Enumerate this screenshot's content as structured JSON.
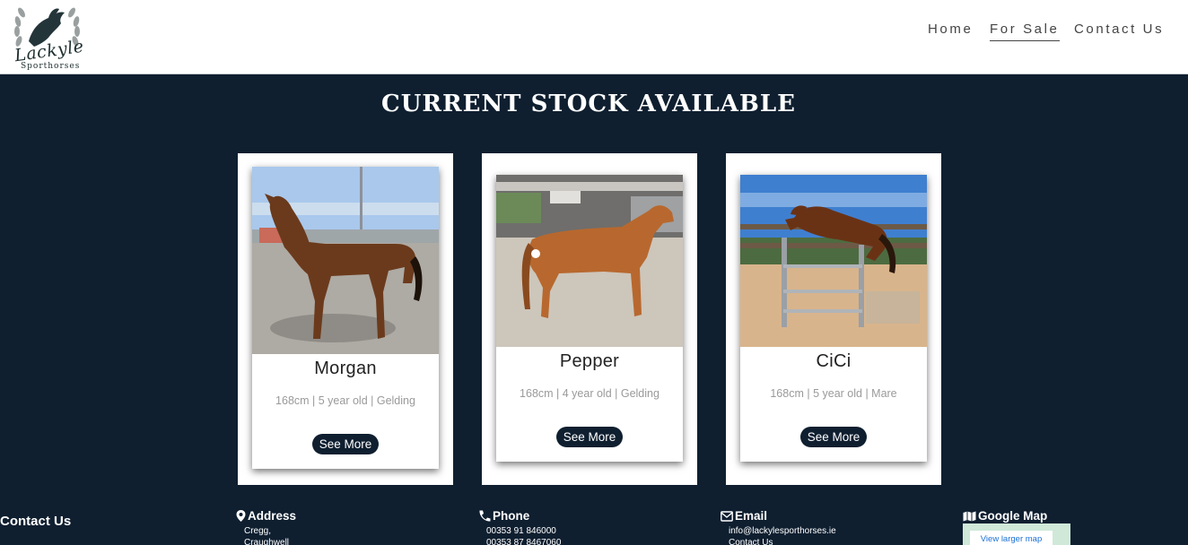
{
  "header": {
    "logo_text": "Lackyle",
    "logo_subtext": "Sporthorses",
    "nav": {
      "home": "Home",
      "for_sale": "For Sale",
      "contact_us": "Contact Us"
    }
  },
  "main": {
    "title": "CURRENT STOCK AVAILABLE",
    "horses": [
      {
        "name": "Morgan",
        "info": "168cm | 5 year old | Gelding",
        "button": "See More"
      },
      {
        "name": "Pepper",
        "info": "168cm | 4 year old | Gelding",
        "button": "See More"
      },
      {
        "name": "CiCi",
        "info": "168cm | 5 year old | Mare",
        "button": "See More"
      }
    ]
  },
  "footer": {
    "title": "Contact Us",
    "address": {
      "heading": "Address",
      "line1": "Cregg,",
      "line2": "Craughwell"
    },
    "phone": {
      "heading": "Phone",
      "line1": "00353 91 846000",
      "line2": "00353 87 8467060"
    },
    "email": {
      "heading": "Email",
      "line1": "info@lackylesporthorses.ie",
      "line2": "Contact Us"
    },
    "map": {
      "heading": "Google Map",
      "link": "View larger map"
    }
  },
  "colors": {
    "navy": "#0f1f30",
    "white": "#ffffff",
    "muted_text": "#9a9a9a",
    "link_blue": "#1a6fd6"
  },
  "icons": [
    "laurel-wreath-logo",
    "map-pin-icon",
    "phone-icon",
    "envelope-icon",
    "map-icon"
  ]
}
